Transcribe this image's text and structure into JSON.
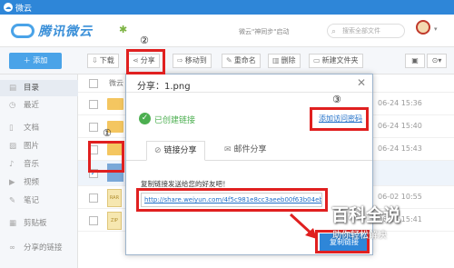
{
  "titlebar": {
    "title": "微云"
  },
  "header": {
    "brand": "腾讯微云",
    "hint": "微云\"神同步\"启动",
    "search_placeholder": "搜索全部文件"
  },
  "toolbar": {
    "add": "＋ 添加",
    "download": "下载",
    "share": "分享",
    "move": "移动到",
    "rename": "重命名",
    "delete": "删除",
    "new_folder": "新建文件夹"
  },
  "sidebar": {
    "items": [
      {
        "label": "目录",
        "icon": "folder-icon"
      },
      {
        "label": "最近",
        "icon": "clock-icon"
      },
      {
        "label": "文档",
        "icon": "document-icon"
      },
      {
        "label": "图片",
        "icon": "image-icon"
      },
      {
        "label": "音乐",
        "icon": "music-icon"
      },
      {
        "label": "视频",
        "icon": "video-icon"
      },
      {
        "label": "笔记",
        "icon": "note-icon"
      },
      {
        "label": "剪贴板",
        "icon": "clipboard-icon"
      },
      {
        "label": "分享的链接",
        "icon": "link-icon"
      }
    ]
  },
  "filelist": {
    "header_name": "微云",
    "dates": [
      "06-24 15:36",
      "06-24 15:40",
      "06-24 15:43",
      "06-02 10:55",
      "06-24 15:41"
    ]
  },
  "dialog": {
    "title": "分享：1.png",
    "created": "已创建链接",
    "add_password": "添加访问密码",
    "tab_link": "链接分享",
    "tab_mail": "邮件分享",
    "copy_label": "复制链接发送给您的好友吧！",
    "link": "http://share.weiyun.com/4f5c981e8cc3aeeb00f63b04ebb59e7d",
    "copy_button": "复制链接"
  },
  "annotations": {
    "n1": "①",
    "n2": "②",
    "n3": "③"
  },
  "watermark": {
    "big": "百科全说",
    "small": "助你轻松解决"
  },
  "colors": {
    "accent": "#2e86d8",
    "annotation": "#e02020",
    "success": "#4caf50"
  }
}
